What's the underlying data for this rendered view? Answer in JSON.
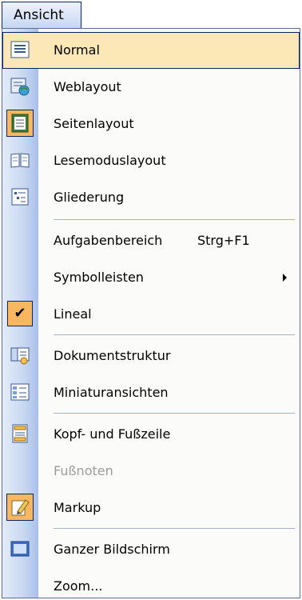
{
  "menubar": {
    "tab_label": "Ansicht"
  },
  "menu": {
    "items": [
      {
        "label": "Normal",
        "icon": "normal-view-icon"
      },
      {
        "label": "Weblayout",
        "icon": "web-layout-icon"
      },
      {
        "label": "Seitenlayout",
        "icon": "page-layout-icon"
      },
      {
        "label": "Lesemoduslayout",
        "icon": "reading-mode-icon"
      },
      {
        "label": "Gliederung",
        "icon": "outline-icon"
      },
      {
        "label": "Aufgabenbereich",
        "shortcut": "Strg+F1"
      },
      {
        "label": "Symbolleisten",
        "submenu": true
      },
      {
        "label": "Lineal",
        "checked": true
      },
      {
        "label": "Dokumentstruktur",
        "icon": "document-map-icon"
      },
      {
        "label": "Miniaturansichten",
        "icon": "thumbnails-icon"
      },
      {
        "label": "Kopf- und Fußzeile",
        "icon": "header-footer-icon"
      },
      {
        "label": "Fußnoten",
        "disabled": true
      },
      {
        "label": "Markup",
        "icon": "markup-icon"
      },
      {
        "label": "Ganzer Bildschirm",
        "icon": "full-screen-icon"
      },
      {
        "label": "Zoom..."
      }
    ]
  }
}
